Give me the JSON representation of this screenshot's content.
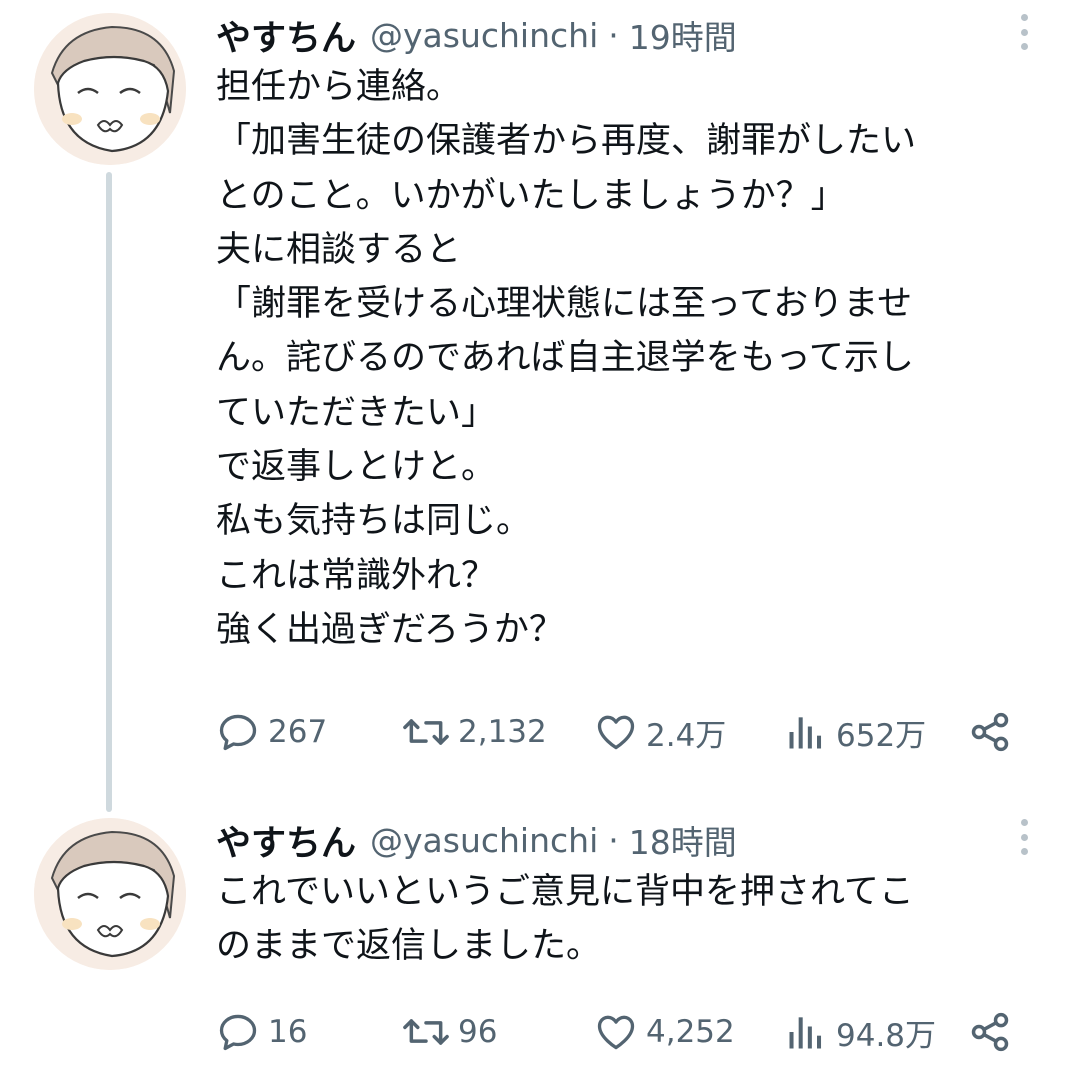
{
  "tweets": [
    {
      "display_name": "やすちん",
      "handle": "@yasuchinchi",
      "separator": "·",
      "time": "19時間",
      "text_lines": [
        "担任から連絡。",
        "「加害生徒の保護者から再度、謝罪がしたい",
        "とのこと。いかがいたしましょうか？」",
        "夫に相談すると",
        "「謝罪を受ける心理状態には至っておりませ",
        "ん。詫びるのであれば自主退学をもって示し",
        "ていただきたい」",
        "で返事しとけと。",
        "私も気持ちは同じ。",
        "これは常識外れ？",
        "強く出過ぎだろうか？"
      ],
      "stats": {
        "replies": "267",
        "retweets": "2,132",
        "likes": "2.4万",
        "views": "652万"
      }
    },
    {
      "display_name": "やすちん",
      "handle": "@yasuchinchi",
      "separator": "·",
      "time": "18時間",
      "text_lines": [
        "これでいいというご意見に背中を押されてこ",
        "のままで返信しました。"
      ],
      "stats": {
        "replies": "16",
        "retweets": "96",
        "likes": "4,252",
        "views": "94.8万"
      }
    }
  ],
  "icons": {
    "reply": "reply-icon",
    "retweet": "retweet-icon",
    "like": "heart-icon",
    "views": "views-icon",
    "share": "share-icon",
    "more": "more-icon"
  },
  "colors": {
    "text": "#0f1419",
    "secondary": "#536471",
    "thread_line": "#cfd9de",
    "avatar_bg": "#f7ece4"
  }
}
